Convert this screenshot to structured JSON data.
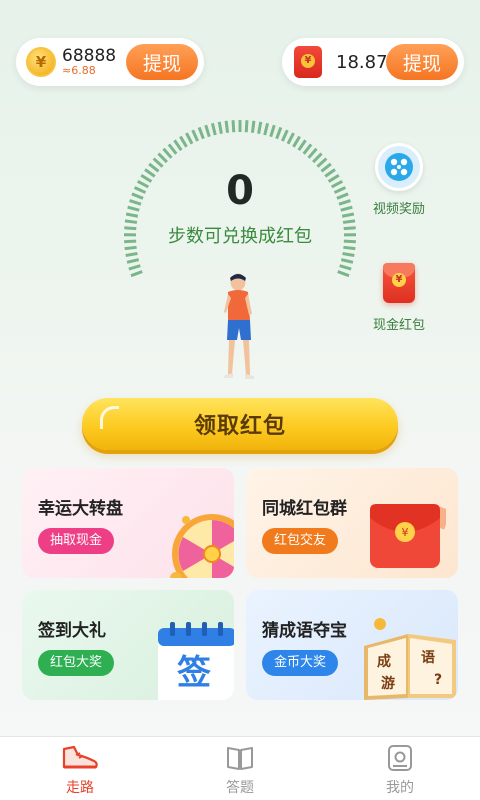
{
  "top_bar": {
    "coins": {
      "value": "68888",
      "sub_value": "≈6.88",
      "withdraw_label": "提现",
      "icon_glyph": "¥"
    },
    "red_packet": {
      "value": "18.87",
      "withdraw_label": "提现"
    }
  },
  "step_gauge": {
    "steps": "0",
    "caption": "步数可兑换成红包",
    "progress_fraction": 0
  },
  "side_actions": [
    {
      "label": "视频奖励",
      "icon": "video-play-icon"
    },
    {
      "label": "现金红包",
      "icon": "red-packet-icon"
    }
  ],
  "claim_button": {
    "label": "领取红包"
  },
  "cards": [
    {
      "title": "幸运大转盘",
      "tag": "抽取现金",
      "tag_color": "#ed3e86",
      "art": "prize-wheel"
    },
    {
      "title": "同城红包群",
      "tag": "红包交友",
      "tag_color": "#f07a1c",
      "art": "red-envelope"
    },
    {
      "title": "签到大礼",
      "tag": "红包大奖",
      "tag_color": "#2eb052",
      "art": "calendar",
      "art_text": "签"
    },
    {
      "title": "猜成语夺宝",
      "tag": "金币大奖",
      "tag_color": "#2f86ea",
      "art": "idiom-book",
      "art_text": [
        "成",
        "语",
        "游",
        "?"
      ]
    }
  ],
  "bottom_nav": {
    "items": [
      {
        "label": "走路",
        "icon": "shoe-icon",
        "active": true
      },
      {
        "label": "答题",
        "icon": "book-icon",
        "active": false
      },
      {
        "label": "我的",
        "icon": "profile-icon",
        "active": false
      }
    ],
    "active_color": "#e8412a"
  }
}
